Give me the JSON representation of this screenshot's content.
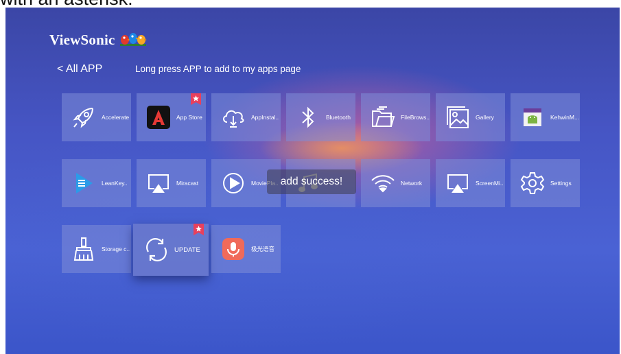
{
  "caption": "with an asterisk.",
  "brand": {
    "name": "ViewSonic"
  },
  "nav": {
    "back_label": "< All APP",
    "hint": "Long press APP to add to my apps page"
  },
  "toast": "add success!",
  "apps": [
    {
      "label": "Accelerate",
      "icon": "rocket-icon"
    },
    {
      "label": "App Store",
      "icon": "app-store-icon",
      "starred": true
    },
    {
      "label": "AppInstal..",
      "icon": "cloud-download-icon"
    },
    {
      "label": "Bluetooth",
      "icon": "bluetooth-icon"
    },
    {
      "label": "FileBrows..",
      "icon": "folder-icon"
    },
    {
      "label": "Gallery",
      "icon": "gallery-icon"
    },
    {
      "label": "KehwinM...",
      "icon": "android-icon"
    },
    {
      "label": "LeanKey..",
      "icon": "leankey-icon"
    },
    {
      "label": "Miracast",
      "icon": "cast-icon"
    },
    {
      "label": "MoviePla..",
      "icon": "play-icon"
    },
    {
      "label": "",
      "icon": "music-icon"
    },
    {
      "label": "Network",
      "icon": "wifi-icon"
    },
    {
      "label": "ScreenMi..",
      "icon": "screen-mirror-icon"
    },
    {
      "label": "Settings",
      "icon": "gear-icon"
    },
    {
      "label": "Storage c..",
      "icon": "broom-icon"
    },
    {
      "label": "UPDATE",
      "icon": "refresh-icon",
      "starred": true,
      "focused": true
    },
    {
      "label": "极光语音",
      "icon": "microphone-icon"
    }
  ]
}
